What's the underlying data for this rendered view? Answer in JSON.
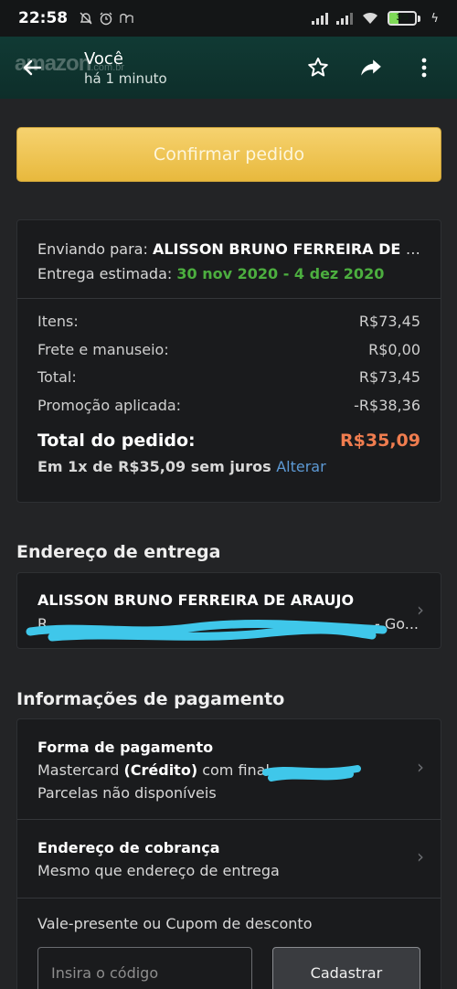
{
  "status_bar": {
    "time": "22:58",
    "left_icons": [
      "mute-icon",
      "alarm-icon",
      "rf-icon"
    ],
    "battery": "35",
    "battery_level": 0.35,
    "colors": {
      "battery": "#7ed957"
    }
  },
  "header": {
    "title": "Você",
    "subtitle": "há 1 minuto",
    "logo_text": "amazon",
    "logo_suffix": ".com.br",
    "icons": [
      "back-arrow-icon",
      "star-icon",
      "share-icon",
      "more-vert-icon"
    ]
  },
  "confirm_button": "Confirmar pedido",
  "summary": {
    "shipping_label": "Enviando para: ",
    "shipping_name": "ALISSON BRUNO FERREIRA DE ARAUJO",
    "delivery_label": "Entrega estimada: ",
    "delivery_date": "30 nov 2020 - 4 dez 2020",
    "rows": [
      {
        "label": "Itens:",
        "value": "R$73,45"
      },
      {
        "label": "Frete e manuseio:",
        "value": "R$0,00"
      },
      {
        "label": "Total:",
        "value": "R$73,45"
      },
      {
        "label": "Promoção aplicada:",
        "value": "-R$38,36"
      }
    ],
    "order_total_label": "Total do pedido:",
    "order_total_value": "R$35,09",
    "installment_text": "Em 1x de R$35,09 sem juros",
    "installment_link": "Alterar"
  },
  "address_section": {
    "title": "Endereço de entrega",
    "name": "ALISSON BRUNO FERREIRA DE ARAUJO",
    "line_start": "R",
    "line_end": "- Go..."
  },
  "payment_section": {
    "title": "Informações de pagamento",
    "method_title": "Forma de pagamento",
    "card_prefix": "Mastercard ",
    "card_type": "(Crédito)",
    "card_suffix": " com final",
    "installments": "Parcelas não disponíveis",
    "billing_title": "Endereço de cobrança",
    "billing_value": "Mesmo que endereço de entrega",
    "coupon_label": "Vale-presente ou Cupom de desconto",
    "coupon_placeholder": "Insira o código",
    "coupon_button": "Cadastrar"
  }
}
